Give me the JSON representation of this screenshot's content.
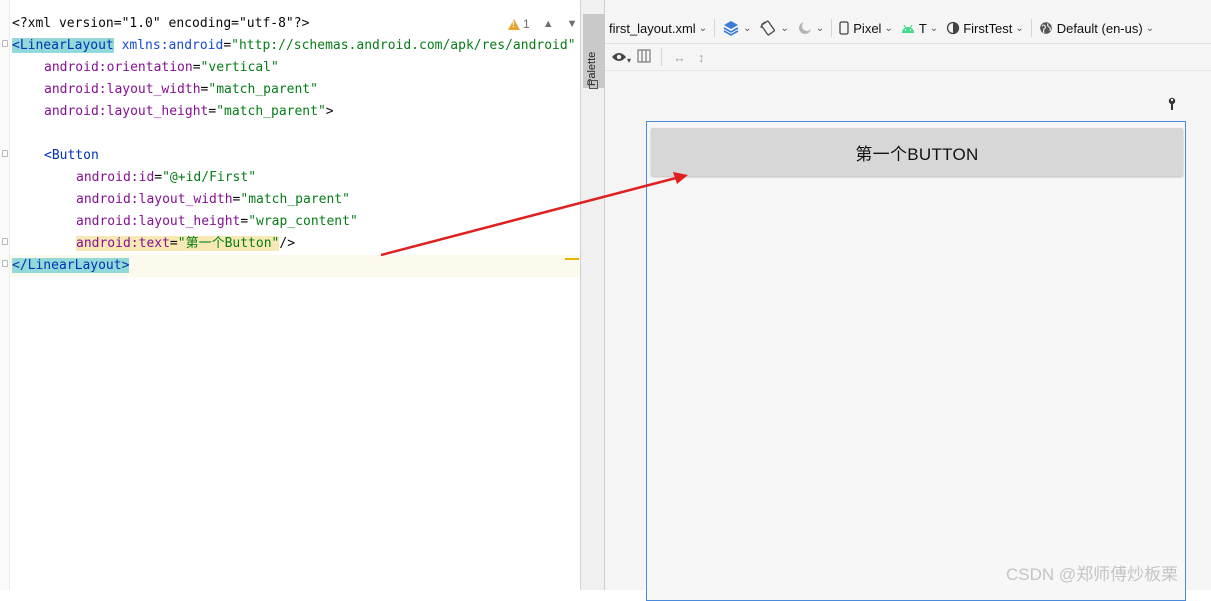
{
  "editor": {
    "warning_count": "1",
    "lines": {
      "l1": "<?xml version=\"1.0\" encoding=\"utf-8\"?>",
      "l2_tag": "<LinearLayout",
      "l2_ns_attr": "xmlns:android",
      "l2_eq": "=",
      "l2_val": "\"http://schemas.android.com/apk/res/android\"",
      "l3_attr": "android:orientation",
      "l3_val": "\"vertical\"",
      "l4_attr": "android:layout_width",
      "l4_val": "\"match_parent\"",
      "l5_attr": "android:layout_height",
      "l5_val": "\"match_parent\"",
      "l5_end": ">",
      "l7_tag": "<Button",
      "l8_attr": "android:id",
      "l8_val": "\"@+id/First\"",
      "l9_attr": "android:layout_width",
      "l9_val": "\"match_parent\"",
      "l10_attr": "android:layout_height",
      "l10_val": "\"wrap_content\"",
      "l11_attr": "android:text",
      "l11_val": "\"第一个Button\"",
      "l11_end": "/>",
      "l12_tag": "</LinearLayout>"
    }
  },
  "palette": {
    "label": "Palette"
  },
  "toolbar": {
    "file": "first_layout.xml",
    "device": "Pixel",
    "api": "T",
    "theme": "FirstTest",
    "locale": "Default (en-us)"
  },
  "preview": {
    "button_text": "第一个BUTTON"
  },
  "watermark": "CSDN @郑师傅炒板栗",
  "colors": {
    "accent_border": "#4a8ad8",
    "arrow": "#e02020"
  }
}
